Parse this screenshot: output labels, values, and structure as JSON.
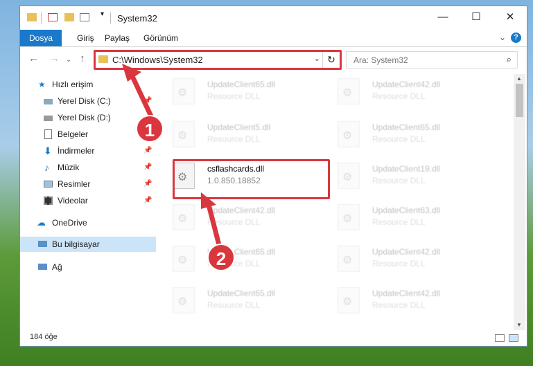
{
  "window": {
    "title": "System32"
  },
  "ribbon": {
    "tabs": [
      "Dosya",
      "Giriş",
      "Paylaş",
      "Görünüm"
    ]
  },
  "address": {
    "path": "C:\\Windows\\System32",
    "search_placeholder": "Ara: System32"
  },
  "nav": {
    "items": [
      {
        "label": "Hızlı erişim",
        "icon": "star-icon",
        "pinned": false
      },
      {
        "label": "Yerel Disk (C:)",
        "icon": "drive-icon",
        "pinned": true
      },
      {
        "label": "Yerel Disk (D:)",
        "icon": "drive-icon",
        "pinned": true
      },
      {
        "label": "Belgeler",
        "icon": "document-icon",
        "pinned": true
      },
      {
        "label": "İndirmeler",
        "icon": "download-icon",
        "pinned": true
      },
      {
        "label": "Müzik",
        "icon": "music-icon",
        "pinned": true
      },
      {
        "label": "Resimler",
        "icon": "picture-icon",
        "pinned": true
      },
      {
        "label": "Videolar",
        "icon": "video-icon",
        "pinned": true
      },
      {
        "label": "OneDrive",
        "icon": "cloud-icon",
        "pinned": false
      },
      {
        "label": "Bu bilgisayar",
        "icon": "computer-icon",
        "pinned": false,
        "selected": true
      },
      {
        "label": "Ağ",
        "icon": "network-icon",
        "pinned": false
      }
    ]
  },
  "files": [
    {
      "name": "UpdateClient65.dll",
      "sub": "Resource DLL"
    },
    {
      "name": "UpdateClient42.dll",
      "sub": "Resource DLL"
    },
    {
      "name": "UpdateClient5.dll",
      "sub": "Resource DLL"
    },
    {
      "name": "UpdateClient65.dll",
      "sub": "Resource DLL"
    },
    {
      "name": "csflashcards.dll",
      "sub": "1.0.850.18852",
      "highlighted": true
    },
    {
      "name": "UpdateClient19.dll",
      "sub": "Resource DLL"
    },
    {
      "name": "UpdateClient42.dll",
      "sub": "Resource DLL"
    },
    {
      "name": "UpdateClient63.dll",
      "sub": "Resource DLL"
    },
    {
      "name": "UpdateClient65.dll",
      "sub": "Resource DLL"
    },
    {
      "name": "UpdateClient42.dll",
      "sub": "Resource DLL"
    },
    {
      "name": "UpdateClient65.dll",
      "sub": "Resource DLL"
    },
    {
      "name": "UpdateClient42.dll",
      "sub": "Resource DLL"
    }
  ],
  "status": {
    "count": "184 öğe"
  },
  "callouts": [
    "1",
    "2"
  ],
  "colors": {
    "accent": "#1979ca",
    "callout": "#d9363e"
  }
}
